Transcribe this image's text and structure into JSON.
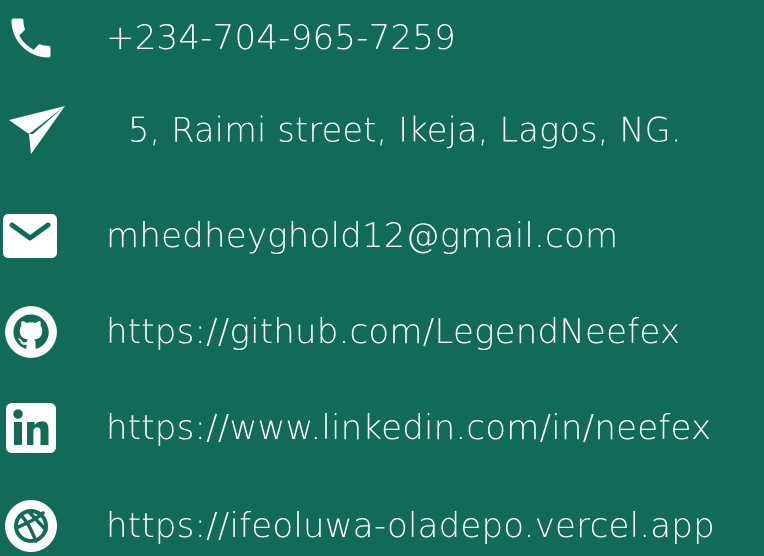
{
  "contacts": {
    "phone": {
      "text": "+234-704-965-7259",
      "icon": "phone-icon"
    },
    "address": {
      "text": "5, Raimi street, Ikeja, Lagos, NG.",
      "icon": "send-icon"
    },
    "email": {
      "text": "mhedheyghold12@gmail.com",
      "icon": "mail-icon"
    },
    "github": {
      "text": "https://github.com/LegendNeefex",
      "icon": "github-icon"
    },
    "linkedin": {
      "text": "https://www.linkedin.com/in/neefex",
      "icon": "linkedin-icon"
    },
    "website": {
      "text": "https://ifeoluwa-oladepo.vercel.app",
      "icon": "dribbble-icon"
    }
  },
  "colors": {
    "background": "#116b58",
    "foreground": "#ffffff"
  }
}
